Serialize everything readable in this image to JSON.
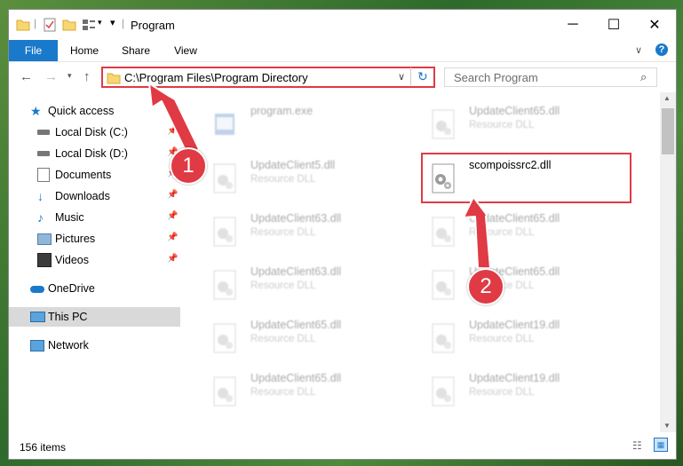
{
  "window": {
    "title": "Program"
  },
  "ribbon": {
    "tabs": [
      "File",
      "Home",
      "Share",
      "View"
    ]
  },
  "address": {
    "path": "C:\\Program Files\\Program Directory"
  },
  "search": {
    "placeholder": "Search Program"
  },
  "sidebar": {
    "items": [
      {
        "label": "Quick access",
        "icon": "star-icon"
      },
      {
        "label": "Local Disk (C:)",
        "icon": "drive-icon",
        "pinned": true
      },
      {
        "label": "Local Disk (D:)",
        "icon": "drive-icon",
        "pinned": true
      },
      {
        "label": "Documents",
        "icon": "documents-icon",
        "pinned": true
      },
      {
        "label": "Downloads",
        "icon": "download-icon",
        "pinned": true
      },
      {
        "label": "Music",
        "icon": "music-icon",
        "pinned": true
      },
      {
        "label": "Pictures",
        "icon": "pictures-icon",
        "pinned": true
      },
      {
        "label": "Videos",
        "icon": "videos-icon",
        "pinned": true
      },
      {
        "label": "OneDrive",
        "icon": "cloud-icon"
      },
      {
        "label": "This PC",
        "icon": "computer-icon",
        "selected": true
      },
      {
        "label": "Network",
        "icon": "network-icon"
      }
    ]
  },
  "files": [
    {
      "name": "program.exe",
      "type": ""
    },
    {
      "name": "UpdateClient65.dll",
      "type": "Resource DLL"
    },
    {
      "name": "UpdateClient5.dll",
      "type": "Resource DLL"
    },
    {
      "name": "scompoissrc2.dll",
      "type": "",
      "highlighted": true
    },
    {
      "name": "UpdateClient63.dll",
      "type": "Resource DLL"
    },
    {
      "name": "UpdateClient65.dll",
      "type": "Resource DLL"
    },
    {
      "name": "UpdateClient63.dll",
      "type": "Resource DLL"
    },
    {
      "name": "UpdateClient65.dll",
      "type": "Resource DLL"
    },
    {
      "name": "UpdateClient65.dll",
      "type": "Resource DLL"
    },
    {
      "name": "UpdateClient19.dll",
      "type": "Resource DLL"
    },
    {
      "name": "UpdateClient65.dll",
      "type": "Resource DLL"
    },
    {
      "name": "UpdateClient19.dll",
      "type": "Resource DLL"
    }
  ],
  "status": {
    "count": "156 items"
  },
  "annotations": {
    "step1": "1",
    "step2": "2"
  },
  "colors": {
    "accent": "#1979ca",
    "highlight": "#e03a45"
  }
}
